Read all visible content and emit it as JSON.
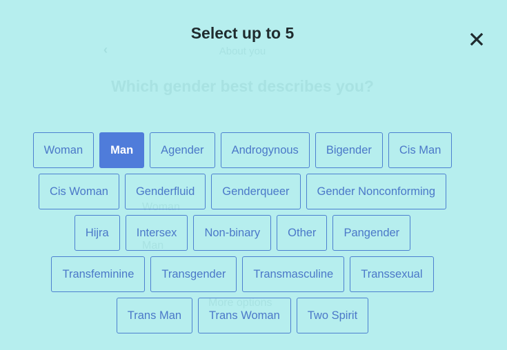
{
  "background": {
    "back_icon": "chevron-left-icon",
    "back_glyph": "‹",
    "subtitle": "About you",
    "question": "Which gender best describes you?",
    "visible_options": [
      "Woman",
      "Man"
    ],
    "more_options_label": "More options"
  },
  "modal": {
    "title": "Select up to 5",
    "close_icon": "close-icon",
    "max_selections": 5,
    "colors": {
      "background": "#b6eeee",
      "chip_border": "#4b7fcf",
      "chip_text": "#4b78c8",
      "selected_fill": "#4f7cda",
      "selected_text": "#ffffff",
      "title_text": "#1f2b2e"
    },
    "rows": [
      [
        {
          "label": "Woman",
          "selected": false
        },
        {
          "label": "Man",
          "selected": true
        },
        {
          "label": "Agender",
          "selected": false
        },
        {
          "label": "Androgynous",
          "selected": false
        },
        {
          "label": "Bigender",
          "selected": false
        },
        {
          "label": "Cis Man",
          "selected": false
        }
      ],
      [
        {
          "label": "Cis Woman",
          "selected": false
        },
        {
          "label": "Genderfluid",
          "selected": false
        },
        {
          "label": "Genderqueer",
          "selected": false
        },
        {
          "label": "Gender Nonconforming",
          "selected": false
        }
      ],
      [
        {
          "label": "Hijra",
          "selected": false
        },
        {
          "label": "Intersex",
          "selected": false
        },
        {
          "label": "Non-binary",
          "selected": false
        },
        {
          "label": "Other",
          "selected": false
        },
        {
          "label": "Pangender",
          "selected": false
        }
      ],
      [
        {
          "label": "Transfeminine",
          "selected": false
        },
        {
          "label": "Transgender",
          "selected": false
        },
        {
          "label": "Transmasculine",
          "selected": false
        },
        {
          "label": "Transsexual",
          "selected": false
        }
      ],
      [
        {
          "label": "Trans Man",
          "selected": false
        },
        {
          "label": "Trans Woman",
          "selected": false
        },
        {
          "label": "Two Spirit",
          "selected": false
        }
      ]
    ]
  }
}
